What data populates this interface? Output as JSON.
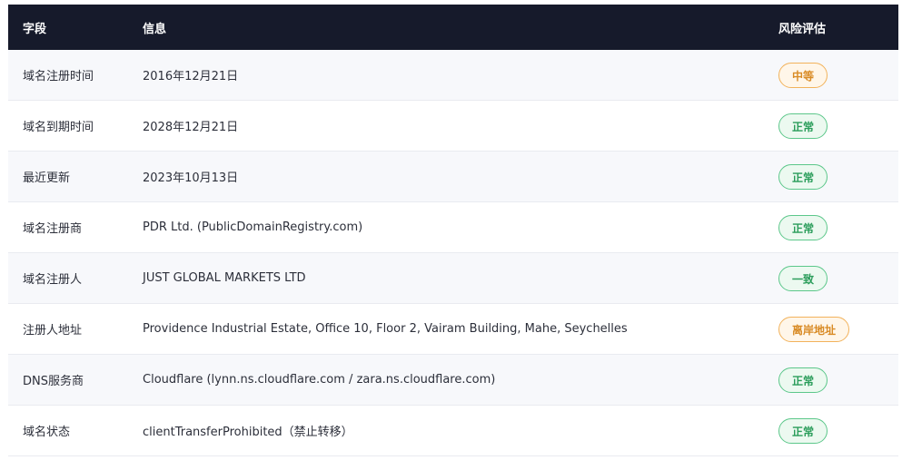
{
  "header": {
    "col_field": "字段",
    "col_info": "信息",
    "col_risk": "风险评估"
  },
  "rows": [
    {
      "field": "域名注册时间",
      "info": "2016年12月21日",
      "risk": "中等",
      "level": "warn"
    },
    {
      "field": "域名到期时间",
      "info": "2028年12月21日",
      "risk": "正常",
      "level": "ok"
    },
    {
      "field": "最近更新",
      "info": "2023年10月13日",
      "risk": "正常",
      "level": "ok"
    },
    {
      "field": "域名注册商",
      "info": "PDR Ltd. (PublicDomainRegistry.com)",
      "risk": "正常",
      "level": "ok"
    },
    {
      "field": "域名注册人",
      "info": "JUST GLOBAL MARKETS LTD",
      "risk": "一致",
      "level": "ok"
    },
    {
      "field": "注册人地址",
      "info": "Providence Industrial Estate, Office 10, Floor 2, Vairam Building, Mahe, Seychelles",
      "risk": "离岸地址",
      "level": "warn"
    },
    {
      "field": "DNS服务商",
      "info": "Cloudflare (lynn.ns.cloudflare.com / zara.ns.cloudflare.com)",
      "risk": "正常",
      "level": "ok"
    },
    {
      "field": "域名状态",
      "info": "clientTransferProhibited（禁止转移）",
      "risk": "正常",
      "level": "ok"
    }
  ],
  "colors": {
    "header_bg": "#161a2b",
    "ok": "#2a9d5a",
    "warn": "#d98b25"
  }
}
